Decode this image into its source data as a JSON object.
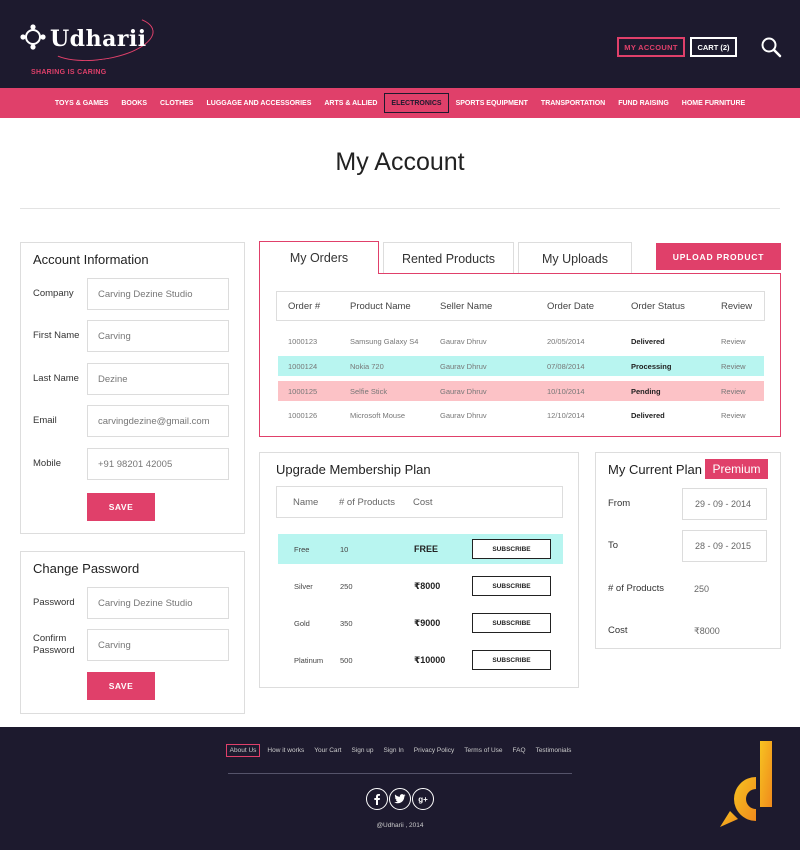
{
  "brand": {
    "name": "Udharii",
    "tagline": "SHARING IS CARING",
    "accent": "#e0406a",
    "dark": "#1d1a2e"
  },
  "header": {
    "my_account": "MY ACCOUNT",
    "cart": "CART (2)",
    "search_icon": "search-icon"
  },
  "nav": {
    "items": [
      "TOYS & GAMES",
      "BOOKS",
      "CLOTHES",
      "LUGGAGE AND ACCESSORIES",
      "ARTS & ALLIED",
      "ELECTRONICS",
      "SPORTS EQUIPMENT",
      "TRANSPORTATION",
      "FUND RAISING",
      "HOME FURNITURE"
    ],
    "active": "ELECTRONICS"
  },
  "page_title": "My Account",
  "account_info": {
    "title": "Account Information",
    "fields": [
      {
        "label": "Company",
        "value": "Carving Dezine Studio"
      },
      {
        "label": "First Name",
        "value": "Carving"
      },
      {
        "label": "Last Name",
        "value": "Dezine"
      },
      {
        "label": "Email",
        "value": "carvingdezine@gmail.com"
      },
      {
        "label": "Mobile",
        "value": "+91 98201 42005"
      }
    ],
    "save": "SAVE"
  },
  "change_password": {
    "title": "Change Password",
    "fields": [
      {
        "label": "Password",
        "value": "Carving Dezine Studio"
      },
      {
        "label": "Confirm Password",
        "value": "Carving"
      }
    ],
    "save": "SAVE"
  },
  "tabs": {
    "items": [
      "My Orders",
      "Rented Products",
      "My Uploads"
    ],
    "active": "My Orders",
    "upload_button": "UPLOAD PRODUCT"
  },
  "orders": {
    "columns": [
      "Order #",
      "Product Name",
      "Seller Name",
      "Order Date",
      "Order Status",
      "Review"
    ],
    "rows": [
      {
        "order": "1000123",
        "product": "Samsung Galaxy S4",
        "seller": "Gaurav Dhruv",
        "date": "20/05/2014",
        "status": "Delivered",
        "review": "Review",
        "highlight": ""
      },
      {
        "order": "1000124",
        "product": "Nokia 720",
        "seller": "Gaurav Dhruv",
        "date": "07/08/2014",
        "status": "Processing",
        "review": "Review",
        "highlight": "#b8f5f0"
      },
      {
        "order": "1000125",
        "product": "Selfie Stick",
        "seller": "Gaurav Dhruv",
        "date": "10/10/2014",
        "status": "Pending",
        "review": "Review",
        "highlight": "#fcc2c6"
      },
      {
        "order": "1000126",
        "product": "Microsoft Mouse",
        "seller": "Gaurav Dhruv",
        "date": "12/10/2014",
        "status": "Delivered",
        "review": "Review",
        "highlight": ""
      }
    ]
  },
  "membership": {
    "title": "Upgrade Membership Plan",
    "columns": [
      "Name",
      "# of Products",
      "Cost"
    ],
    "rows": [
      {
        "name": "Free",
        "products": "10",
        "cost": "FREE",
        "button": "SUBSCRIBE",
        "highlight": "#b8f5f0"
      },
      {
        "name": "Silver",
        "products": "250",
        "cost": "₹8000",
        "button": "SUBSCRIBE",
        "highlight": ""
      },
      {
        "name": "Gold",
        "products": "350",
        "cost": "₹9000",
        "button": "SUBSCRIBE",
        "highlight": ""
      },
      {
        "name": "Platinum",
        "products": "500",
        "cost": "₹10000",
        "button": "SUBSCRIBE",
        "highlight": ""
      }
    ]
  },
  "current_plan": {
    "title": "My Current Plan",
    "badge": "Premium",
    "from_label": "From",
    "from_value": "29 - 09 - 2014",
    "to_label": "To",
    "to_value": "28 - 09 - 2015",
    "products_label": "# of Products",
    "products_value": "250",
    "cost_label": "Cost",
    "cost_value": "₹8000"
  },
  "footer": {
    "links": [
      "About Us",
      "How it works",
      "Your Cart",
      "Sign up",
      "Sign In",
      "Privacy Policy",
      "Terms of Use",
      "FAQ",
      "Testimonials"
    ],
    "active": "About Us",
    "social": [
      {
        "icon": "facebook-icon",
        "glyph": "f"
      },
      {
        "icon": "twitter-icon",
        "glyph": "t"
      },
      {
        "icon": "google-plus-icon",
        "glyph": "g+"
      }
    ],
    "copyright": "@Udharii , 2014"
  }
}
